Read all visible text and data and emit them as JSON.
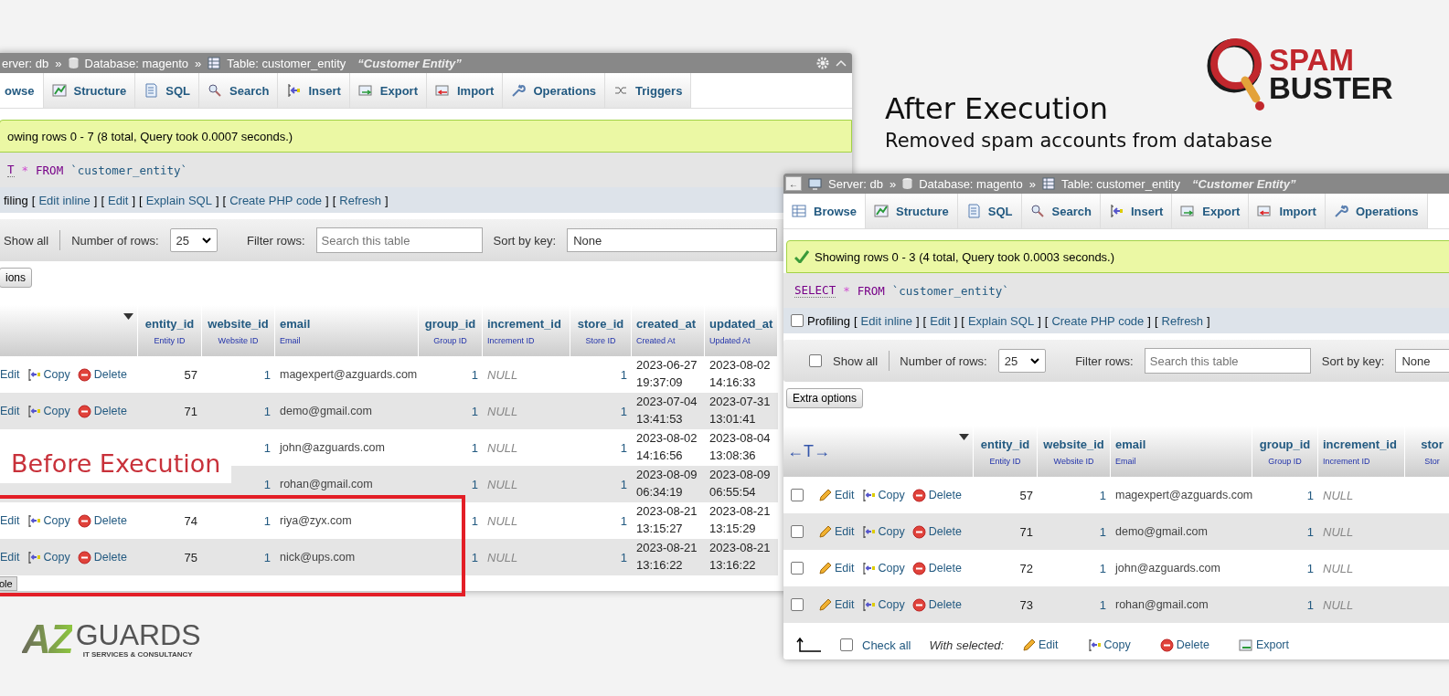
{
  "left_window": {
    "breadcrumb": {
      "server": "erver: db",
      "separator": "»",
      "database": "Database: magento",
      "table": "Table: customer_entity",
      "comment": "“Customer Entity”"
    },
    "tabs": [
      {
        "label": "owse",
        "selected": true
      },
      {
        "label": "Structure",
        "kind": "structure",
        "selected": false
      },
      {
        "label": "SQL",
        "kind": "sql",
        "selected": false
      },
      {
        "label": "Search",
        "kind": "search",
        "selected": false
      },
      {
        "label": "Insert",
        "kind": "insert",
        "selected": false
      },
      {
        "label": "Export",
        "kind": "export",
        "selected": false
      },
      {
        "label": "Import",
        "kind": "import",
        "selected": false
      },
      {
        "label": "Operations",
        "kind": "operations",
        "selected": false
      },
      {
        "label": "Triggers",
        "kind": "triggers",
        "selected": false
      }
    ],
    "success_message": "owing rows 0 - 7 (8 total, Query took 0.0007 seconds.)",
    "query": {
      "keyword": "T",
      "star": "*",
      "from": "FROM",
      "table": "`customer_entity`"
    },
    "profiling": {
      "label": "filing",
      "open": "[",
      "close": "]",
      "links": [
        "Edit inline",
        "Edit",
        "Explain SQL",
        "Create PHP code",
        "Refresh"
      ]
    },
    "navigation": {
      "show_all": "Show all",
      "rows_label": "Number of rows:",
      "rows_value": "25",
      "filter_label": "Filter rows:",
      "filter_placeholder": "Search this table",
      "sort_label": "Sort by key:",
      "sort_value": "None"
    },
    "extra_options": "ions",
    "columns": [
      {
        "name": "entity_id",
        "comment": "Entity ID",
        "kind": "number"
      },
      {
        "name": "website_id",
        "comment": "Website ID",
        "kind": "number"
      },
      {
        "name": "email",
        "comment": "Email",
        "kind": "text"
      },
      {
        "name": "group_id",
        "comment": "Group ID",
        "kind": "number"
      },
      {
        "name": "increment_id",
        "comment": "Increment ID",
        "kind": "null"
      },
      {
        "name": "store_id",
        "comment": "Store ID",
        "kind": "number"
      },
      {
        "name": "created_at",
        "comment": "Created At",
        "kind": "date"
      },
      {
        "name": "updated_at",
        "comment": "Updated At",
        "kind": "date"
      }
    ],
    "rows": [
      {
        "actions": [
          {
            "kind": "edit",
            "label": "Edit"
          },
          {
            "kind": "copy",
            "label": "Copy"
          },
          {
            "kind": "delete",
            "label": "Delete"
          }
        ],
        "cells": [
          "57",
          "1",
          "magexpert@azguards.com",
          "1",
          "NULL",
          "1",
          "2023-06-27 19:37:09",
          "2023-08-02 14:16:33"
        ]
      },
      {
        "actions": [
          {
            "kind": "edit",
            "label": "Edit"
          },
          {
            "kind": "copy",
            "label": "Copy"
          },
          {
            "kind": "delete",
            "label": "Delete"
          }
        ],
        "cells": [
          "71",
          "1",
          "demo@gmail.com",
          "1",
          "NULL",
          "1",
          "2023-07-04 13:41:53",
          "2023-07-31 13:01:41"
        ]
      },
      {
        "cells": [
          null,
          "1",
          "john@azguards.com",
          "1",
          "NULL",
          "1",
          "2023-08-02 14:16:56",
          "2023-08-04 13:08:36"
        ]
      },
      {
        "cells": [
          null,
          "1",
          "rohan@gmail.com",
          "1",
          "NULL",
          "1",
          "2023-08-09 06:34:19",
          "2023-08-09 06:55:54"
        ]
      },
      {
        "actions": [
          {
            "kind": "edit",
            "label": "Edit"
          },
          {
            "kind": "copy",
            "label": "Copy"
          },
          {
            "kind": "delete",
            "label": "Delete"
          }
        ],
        "cells": [
          "74",
          "1",
          "riya@zyx.com",
          "1",
          "NULL",
          "1",
          "2023-08-21 13:15:27",
          "2023-08-21 13:15:29"
        ]
      },
      {
        "actions": [
          {
            "kind": "edit",
            "label": "Edit"
          },
          {
            "kind": "copy",
            "label": "Copy"
          },
          {
            "kind": "delete",
            "label": "Delete"
          }
        ],
        "cells": [
          "75",
          "1",
          "nick@ups.com",
          "1",
          "NULL",
          "1",
          "2023-08-21 13:16:22",
          "2023-08-21 13:16:22"
        ]
      }
    ],
    "console": "ole"
  },
  "before_label": "Before Execution",
  "after_heading": "After Execution",
  "after_subheading": "Removed spam accounts from database",
  "spam_logo": {
    "line1": "SPAM",
    "line2": "BUSTER"
  },
  "right_window": {
    "breadcrumb": {
      "server": "Server: db",
      "separator": "»",
      "database": "Database: magento",
      "table": "Table: customer_entity",
      "comment": "“Customer Entity”"
    },
    "back_button": "←",
    "tabs": [
      {
        "label": "Browse",
        "kind": "browse",
        "selected": true
      },
      {
        "label": "Structure",
        "kind": "structure",
        "selected": false
      },
      {
        "label": "SQL",
        "kind": "sql",
        "selected": false
      },
      {
        "label": "Search",
        "kind": "search",
        "selected": false
      },
      {
        "label": "Insert",
        "kind": "insert",
        "selected": false
      },
      {
        "label": "Export",
        "kind": "export",
        "selected": false
      },
      {
        "label": "Import",
        "kind": "import",
        "selected": false
      },
      {
        "label": "Operations",
        "kind": "operations",
        "selected": false
      }
    ],
    "success_message": "Showing rows 0 - 3 (4 total, Query took 0.0003 seconds.)",
    "query": {
      "keyword": "SELECT",
      "star": "*",
      "from": "FROM",
      "table": "`customer_entity`"
    },
    "profiling": {
      "checked": false,
      "label": "Profiling",
      "open": "[",
      "close": "]",
      "links": [
        "Edit inline",
        "Edit",
        "Explain SQL",
        "Create PHP code",
        "Refresh"
      ]
    },
    "navigation": {
      "show_all_checked": false,
      "show_all": "Show all",
      "rows_label": "Number of rows:",
      "rows_value": "25",
      "filter_label": "Filter rows:",
      "filter_placeholder": "Search this table",
      "sort_label": "Sort by key:",
      "sort_value": "None"
    },
    "extra_options": "Extra options",
    "first_header": "←T→",
    "columns": [
      {
        "name": "entity_id",
        "comment": "Entity ID",
        "kind": "number"
      },
      {
        "name": "website_id",
        "comment": "Website ID",
        "kind": "number"
      },
      {
        "name": "email",
        "comment": "Email",
        "kind": "text"
      },
      {
        "name": "group_id",
        "comment": "Group ID",
        "kind": "number"
      },
      {
        "name": "increment_id",
        "comment": "Increment ID",
        "kind": "null"
      },
      {
        "name": "stor",
        "comment": "Stor",
        "kind": "number"
      }
    ],
    "rows": [
      {
        "checked": false,
        "actions": [
          {
            "kind": "edit",
            "label": "Edit"
          },
          {
            "kind": "copy",
            "label": "Copy"
          },
          {
            "kind": "delete",
            "label": "Delete"
          }
        ],
        "cells": [
          "57",
          "1",
          "magexpert@azguards.com",
          "1",
          "NULL"
        ]
      },
      {
        "checked": false,
        "actions": [
          {
            "kind": "edit",
            "label": "Edit"
          },
          {
            "kind": "copy",
            "label": "Copy"
          },
          {
            "kind": "delete",
            "label": "Delete"
          }
        ],
        "cells": [
          "71",
          "1",
          "demo@gmail.com",
          "1",
          "NULL"
        ]
      },
      {
        "checked": false,
        "actions": [
          {
            "kind": "edit",
            "label": "Edit"
          },
          {
            "kind": "copy",
            "label": "Copy"
          },
          {
            "kind": "delete",
            "label": "Delete"
          }
        ],
        "cells": [
          "72",
          "1",
          "john@azguards.com",
          "1",
          "NULL"
        ]
      },
      {
        "checked": false,
        "actions": [
          {
            "kind": "edit",
            "label": "Edit"
          },
          {
            "kind": "copy",
            "label": "Copy"
          },
          {
            "kind": "delete",
            "label": "Delete"
          }
        ],
        "cells": [
          "73",
          "1",
          "rohan@gmail.com",
          "1",
          "NULL"
        ]
      }
    ],
    "footer": {
      "check_all_checked": false,
      "check_all": "Check all",
      "with_selected": "With selected:",
      "actions": [
        {
          "kind": "edit",
          "label": "Edit"
        },
        {
          "kind": "copy",
          "label": "Copy"
        },
        {
          "kind": "delete",
          "label": "Delete"
        },
        {
          "kind": "export",
          "label": "Export"
        }
      ]
    }
  },
  "az_logo": {
    "mark": "AZ",
    "name": "GUARDS",
    "tagline": "IT SERVICES & CONSULTANCY"
  }
}
